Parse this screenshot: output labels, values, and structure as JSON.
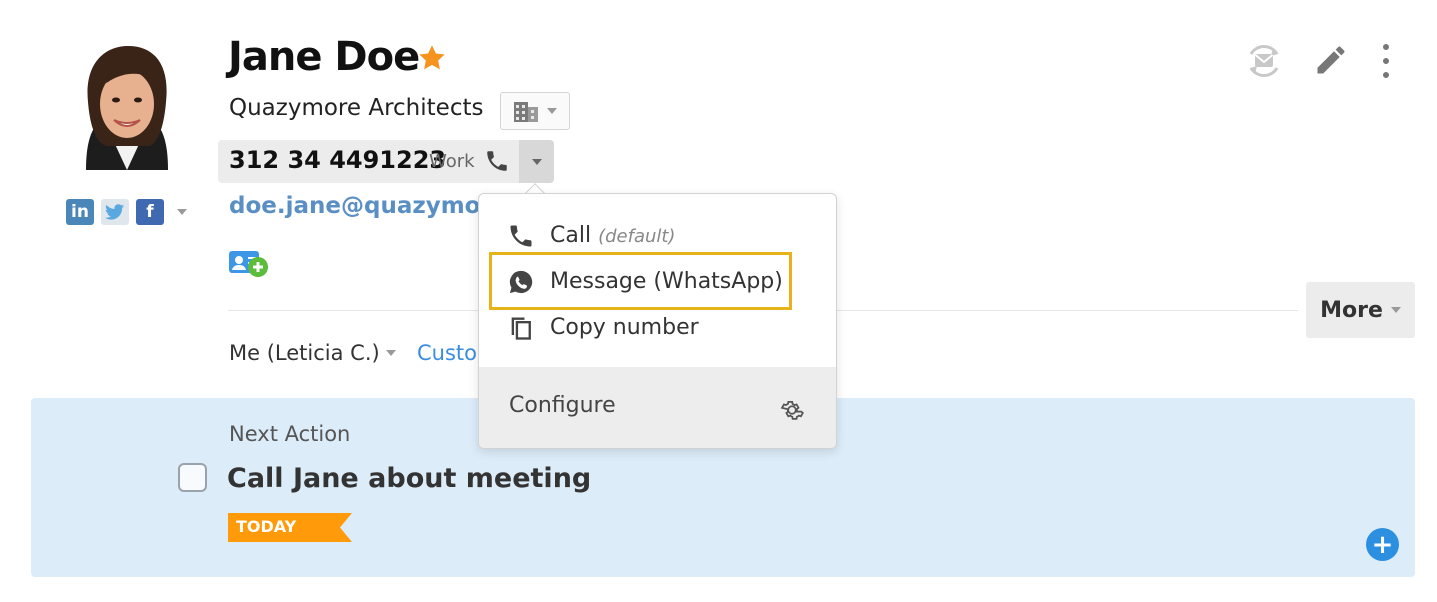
{
  "contact": {
    "name": "Jane Doe",
    "company": "Quazymore Architects",
    "phone": {
      "number": "312 34 4491223",
      "type": "Work"
    },
    "email": "doe.jane@quazymore."
  },
  "owner": {
    "label": "Me (Leticia C.)",
    "custom_link": "Custo"
  },
  "more_button": "More",
  "phone_menu": {
    "items": [
      {
        "label": "Call",
        "hint": "(default)",
        "icon": "phone-icon"
      },
      {
        "label": "Message (WhatsApp)",
        "icon": "whatsapp-icon"
      },
      {
        "label": "Copy number",
        "icon": "copy-icon"
      }
    ],
    "footer_label": "Configure"
  },
  "next_action": {
    "section_label": "Next Action",
    "title": "Call Jane about meeting",
    "due_badge": "TODAY"
  },
  "colors": {
    "accent_blue": "#3a8ee0",
    "email_blue": "#5a8fc4",
    "panel_bg": "#dcecf9",
    "star": "#f6921e",
    "today_badge": "#ff9a0a",
    "highlight": "#e8b21a"
  }
}
